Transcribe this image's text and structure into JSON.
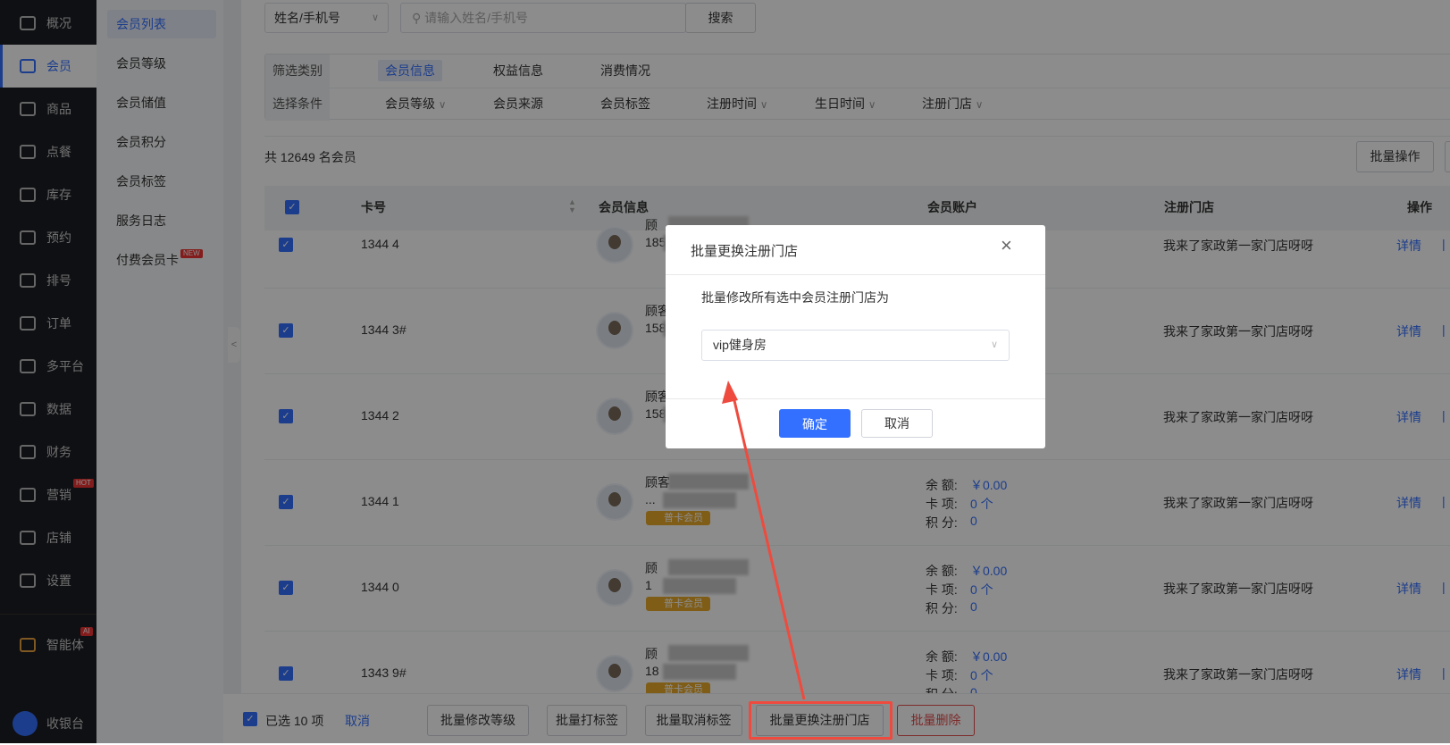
{
  "nav": {
    "items": [
      {
        "label": "概况",
        "icon": "grid-icon"
      },
      {
        "label": "会员",
        "icon": "crown-icon",
        "active": true
      },
      {
        "label": "商品",
        "icon": "box-icon"
      },
      {
        "label": "点餐",
        "icon": "dish-icon"
      },
      {
        "label": "库存",
        "icon": "inventory-icon"
      },
      {
        "label": "预约",
        "icon": "calendar-check-icon"
      },
      {
        "label": "排号",
        "icon": "queue-icon"
      },
      {
        "label": "订单",
        "icon": "clipboard-icon"
      },
      {
        "label": "多平台",
        "icon": "layers-icon"
      },
      {
        "label": "数据",
        "icon": "chart-icon"
      },
      {
        "label": "财务",
        "icon": "yen-icon"
      },
      {
        "label": "营销",
        "icon": "marketing-icon",
        "badge": "HOT"
      },
      {
        "label": "店铺",
        "icon": "store-icon"
      },
      {
        "label": "设置",
        "icon": "settings-icon"
      }
    ],
    "ai": {
      "label": "智能体",
      "badge": "AI"
    },
    "cashier": {
      "label": "收银台"
    }
  },
  "subnav": {
    "items": [
      {
        "label": "会员列表",
        "active": true
      },
      {
        "label": "会员等级"
      },
      {
        "label": "会员储值"
      },
      {
        "label": "会员积分"
      },
      {
        "label": "会员标签"
      },
      {
        "label": "服务日志"
      },
      {
        "label": "付费会员卡",
        "badge": "NEW"
      }
    ]
  },
  "search": {
    "type": "姓名/手机号",
    "placeholder": "请输入姓名/手机号",
    "button": "搜索"
  },
  "filter": {
    "category_label": "筛选类别",
    "categories": [
      "会员信息",
      "权益信息",
      "消费情况"
    ],
    "condition_label": "选择条件",
    "conditions": [
      "会员等级",
      "会员来源",
      "会员标签",
      "注册时间",
      "生日时间",
      "注册门店"
    ]
  },
  "summary": "共 12649 名会员",
  "batch_button": "批量操作",
  "table": {
    "headers": [
      "卡号",
      "会员信息",
      "会员账户",
      "注册门店",
      "操作"
    ],
    "account_labels": [
      "余 额:",
      "卡 项:",
      "积 分:"
    ],
    "rows": [
      {
        "card": "1344 4",
        "name": "顾",
        "phone": "185",
        "level": "",
        "balance": "",
        "items": "",
        "points": "",
        "store": "我来了家政第一家门店呀呀",
        "action": "详情"
      },
      {
        "card": "1344 3#",
        "name": "顾客",
        "phone": "158",
        "level": "",
        "balance": "",
        "items": "",
        "points": "",
        "store": "我来了家政第一家门店呀呀",
        "action": "详情"
      },
      {
        "card": "1344 2",
        "name": "顾客",
        "phone": "158",
        "level": "",
        "balance": "",
        "items": "",
        "points": "",
        "store": "我来了家政第一家门店呀呀",
        "action": "详情"
      },
      {
        "card": "1344 1",
        "name": "顾客15",
        "phone": "...",
        "level": "普卡会员",
        "balance": "￥0.00",
        "items": "0 个",
        "points": "0",
        "store": "我来了家政第一家门店呀呀",
        "action": "详情"
      },
      {
        "card": "1344 0",
        "name": "顾",
        "phone": "1",
        "level": "普卡会员",
        "balance": "￥0.00",
        "items": "0 个",
        "points": "0",
        "store": "我来了家政第一家门店呀呀",
        "action": "详情"
      },
      {
        "card": "1343 9#",
        "name": "顾",
        "phone": "18",
        "level": "普卡会员",
        "balance": "￥0.00",
        "items": "0 个",
        "points": "0",
        "store": "我来了家政第一家门店呀呀",
        "action": "详情"
      }
    ]
  },
  "bottom": {
    "selected": "已选 10 项",
    "cancel": "取消",
    "buttons": [
      "批量修改等级",
      "批量打标签",
      "批量取消标签",
      "批量更换注册门店",
      "批量删除"
    ]
  },
  "dialog": {
    "title": "批量更换注册门店",
    "label": "批量修改所有选中会员注册门店为",
    "value": "vip健身房",
    "confirm": "确定",
    "cancel": "取消"
  },
  "colors": {
    "primary": "#3370ff",
    "danger": "#e34d4d",
    "vip": "#e8a92a",
    "annotation": "#ee4b3e"
  }
}
